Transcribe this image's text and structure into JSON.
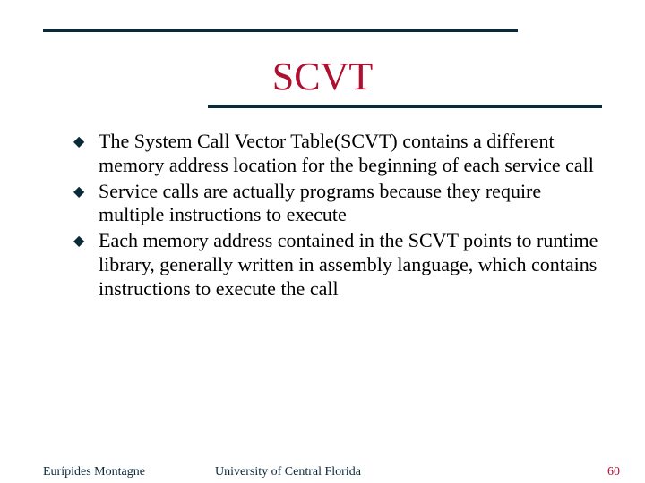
{
  "title": "SCVT",
  "bullets": [
    "The System Call Vector Table(SCVT) contains a different memory address location for the beginning of each service call",
    "Service calls are actually programs because they require multiple instructions to execute",
    "Each memory address contained in the SCVT points to runtime library, generally written in assembly language, which contains instructions to execute the call"
  ],
  "footer": {
    "left": "Eurípides Montagne",
    "center": "University of Central Florida",
    "right": "60"
  },
  "colors": {
    "accent_rule": "#0a2a3a",
    "title_color": "#b01030",
    "page_number_color": "#b01030"
  }
}
